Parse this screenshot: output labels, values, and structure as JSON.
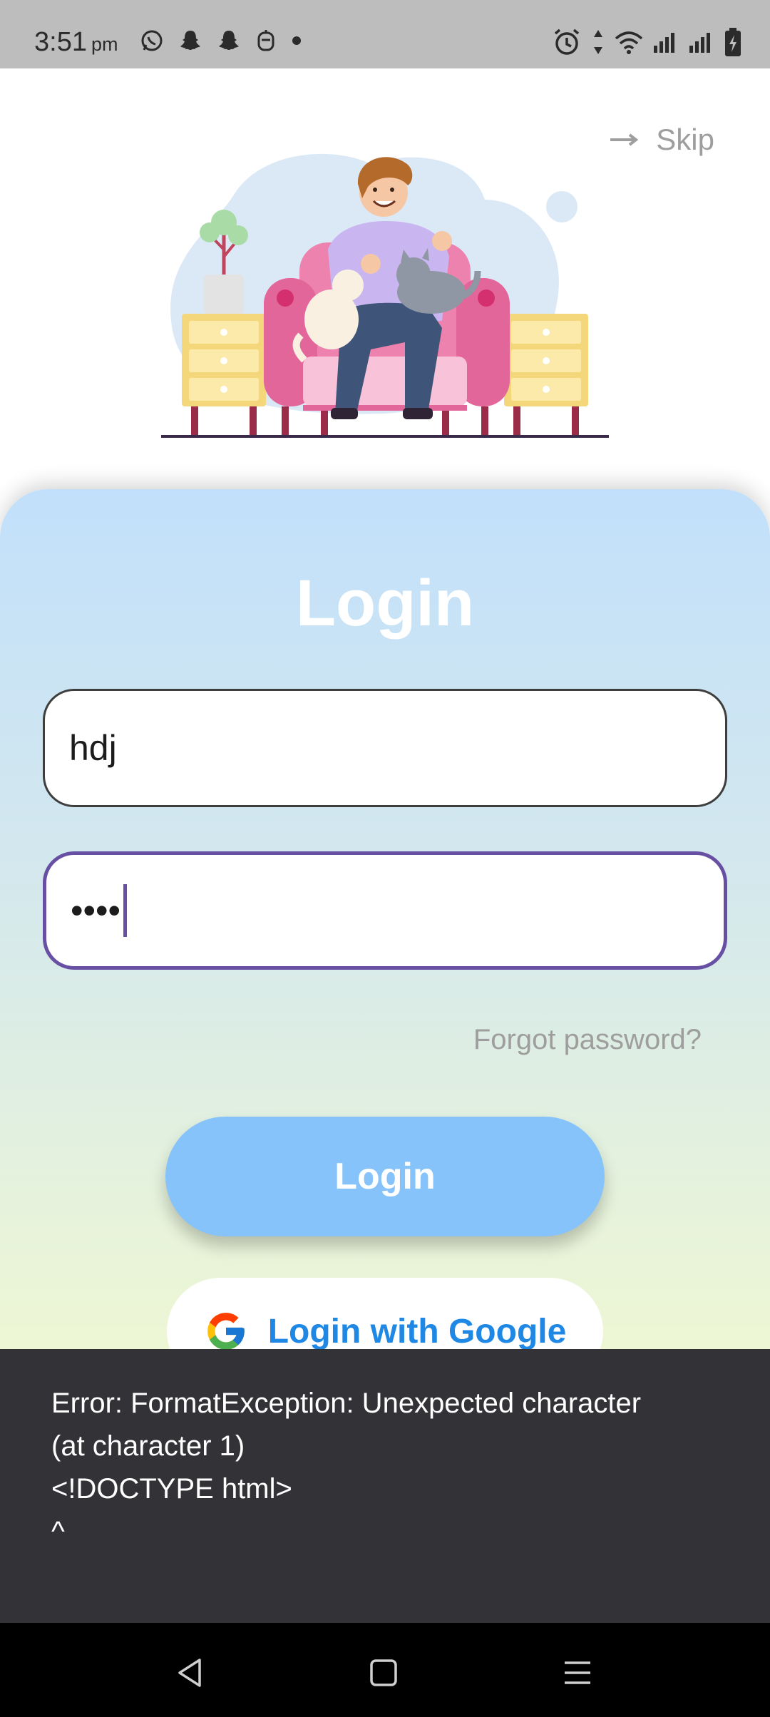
{
  "status_bar": {
    "time": "3:51",
    "ampm": "pm",
    "left_icons": [
      "whatsapp-icon",
      "snapchat-icon",
      "snapchat-icon",
      "app-icon",
      "dot-icon"
    ],
    "right_icons": [
      "alarm-icon",
      "data-arrows-icon",
      "wifi-icon",
      "signal-icon",
      "signal-icon",
      "battery-charging-icon"
    ]
  },
  "header": {
    "skip_label": "Skip",
    "skip_icon": "arrow-right-icon"
  },
  "login_form": {
    "title": "Login",
    "username_value": "hdj",
    "password_value": "••••",
    "forgot_password": "Forgot password?",
    "login_button": "Login",
    "google_button": "Login with Google",
    "google_icon": "google-icon"
  },
  "snackbar": {
    "message": "Error: FormatException: Unexpected character\n(at character 1)\n<!DOCTYPE html>\n^"
  },
  "nav_bar": {
    "icons": [
      "back-icon",
      "home-icon",
      "menu-icon"
    ]
  },
  "colors": {
    "focus_border": "#6750a4",
    "login_button": "#87c3fb",
    "google_text": "#1f88e5",
    "snackbar_bg": "#333236"
  }
}
